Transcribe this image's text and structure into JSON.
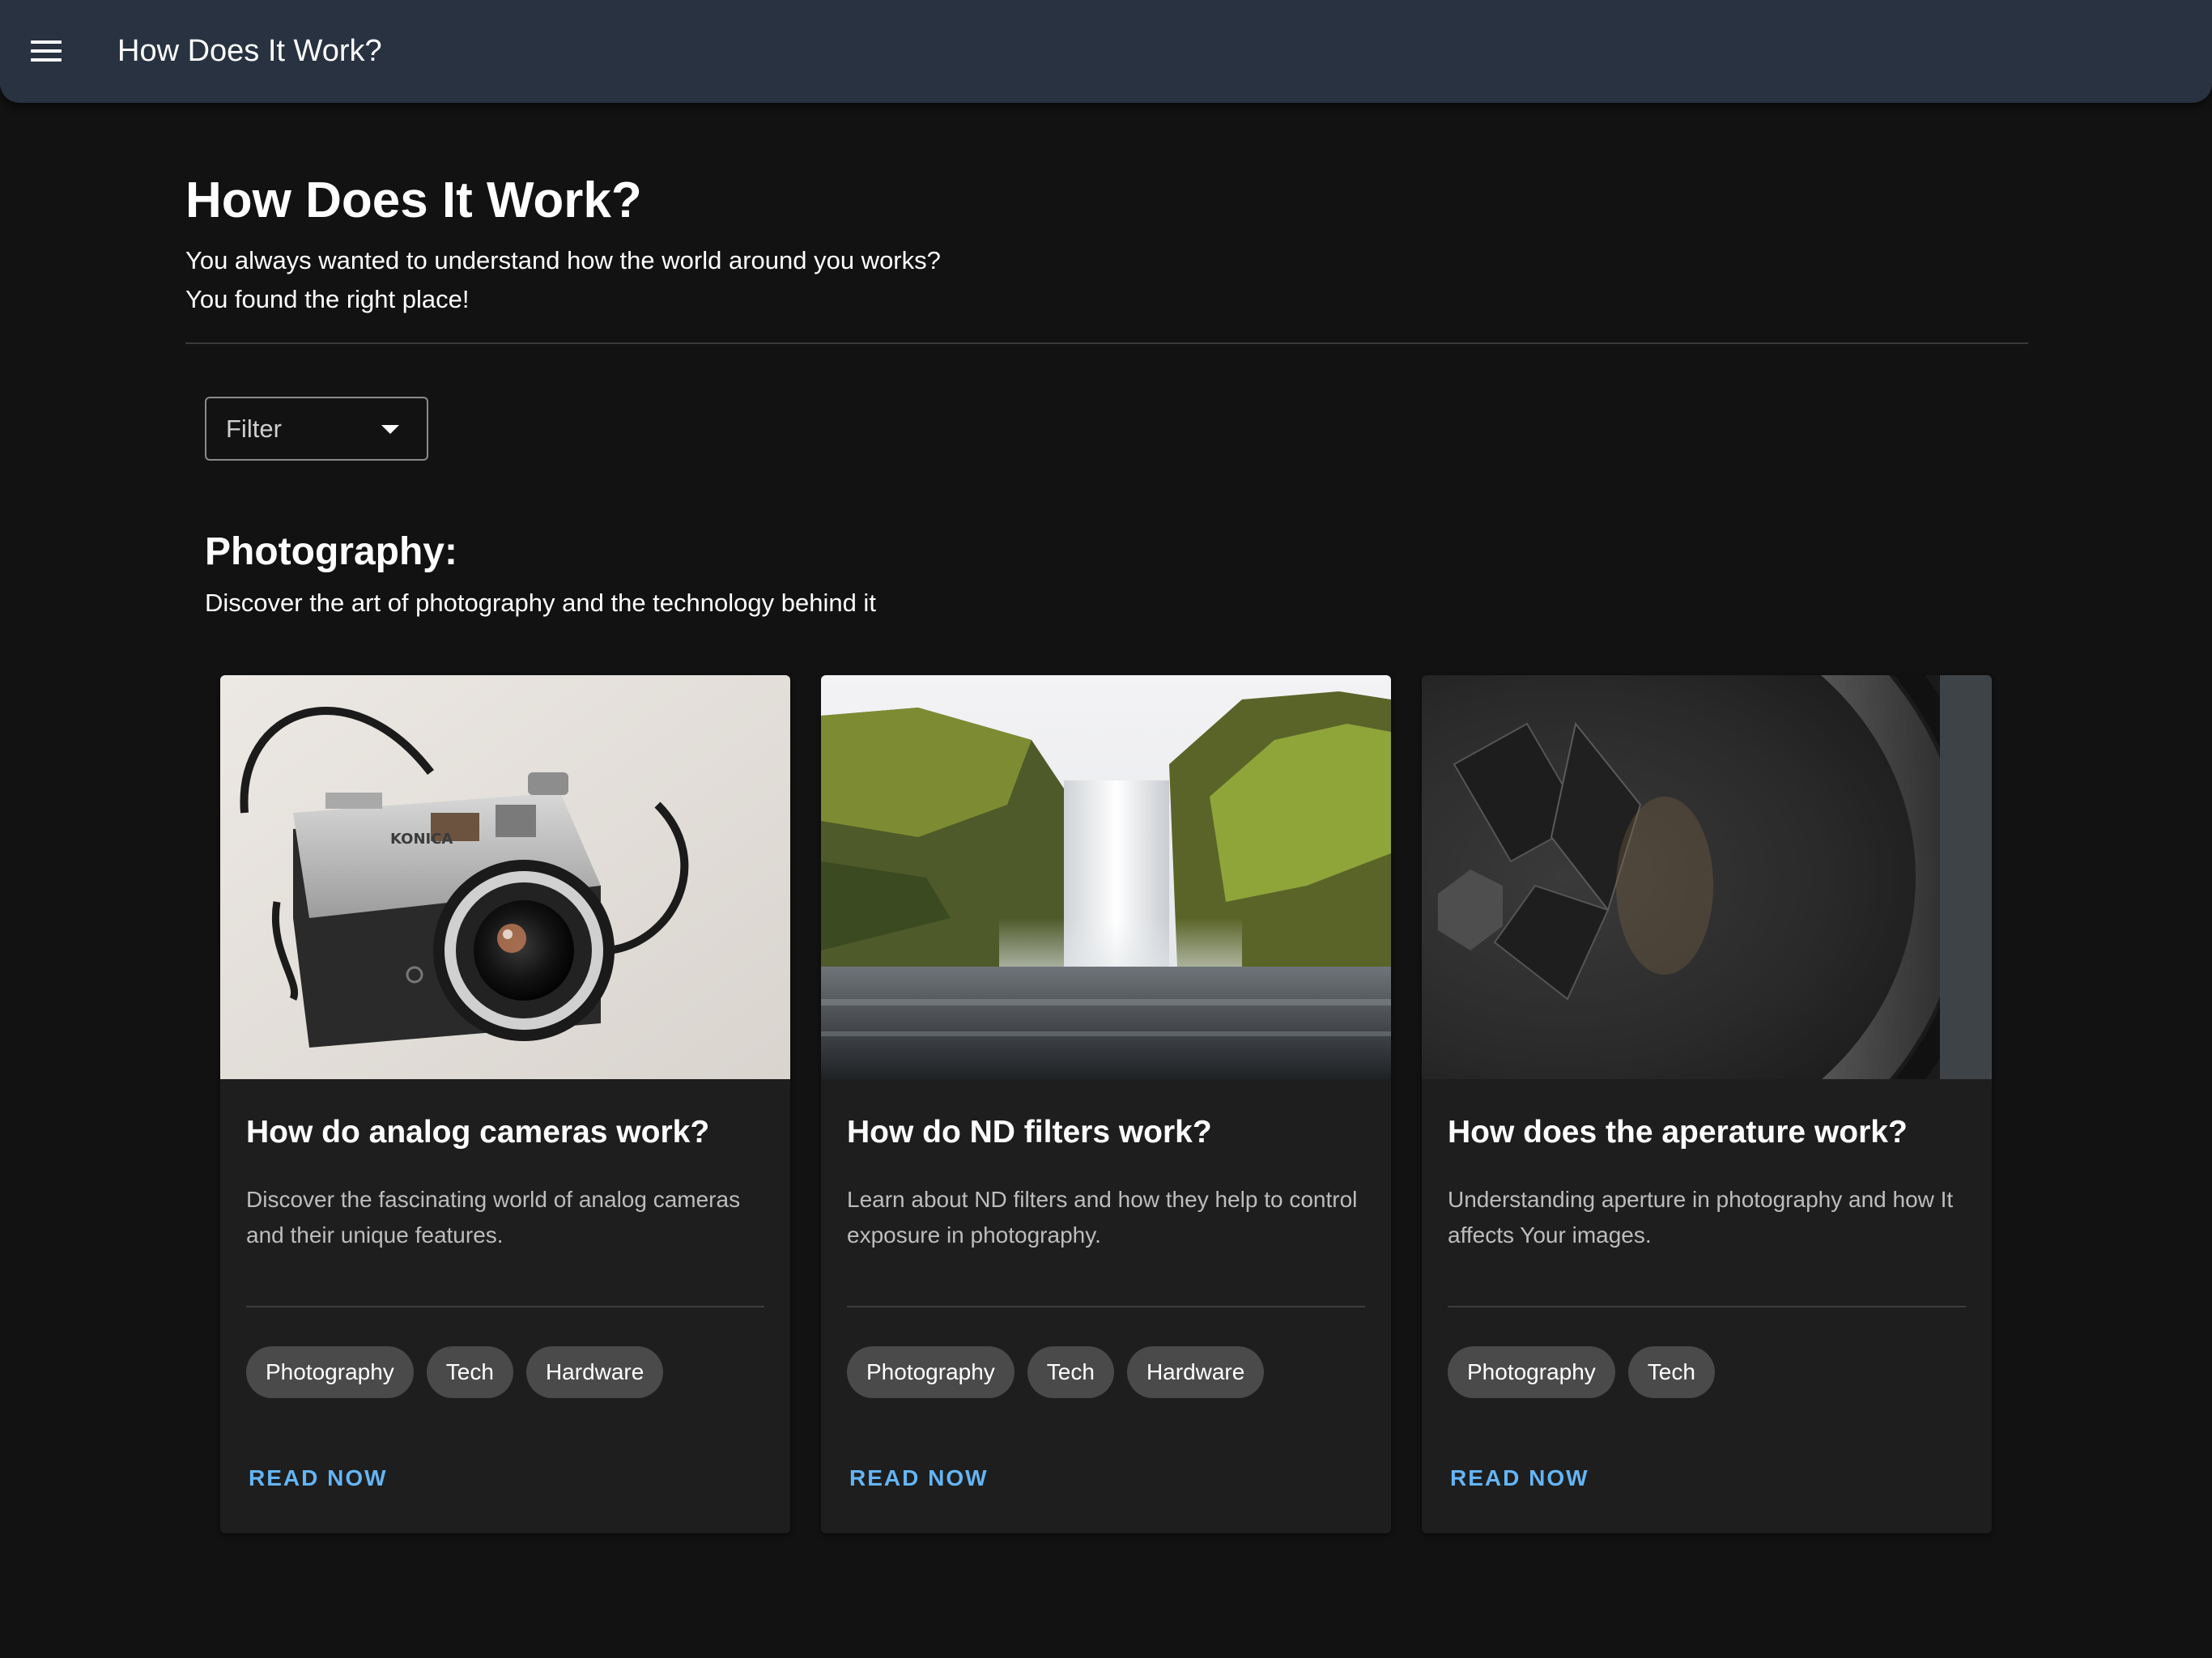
{
  "appbar": {
    "title": "How Does It Work?"
  },
  "header": {
    "title": "How Does It Work?",
    "subtitle_line1": "You always wanted to understand how the world around you works?",
    "subtitle_line2": "You found the right place!"
  },
  "filter": {
    "label": "Filter"
  },
  "section": {
    "title": "Photography:",
    "description": "Discover the art of photography and the technology behind it"
  },
  "cards": [
    {
      "title": "How do analog cameras work?",
      "description": "Discover the fascinating world of analog cameras and their unique features.",
      "tags": [
        "Photography",
        "Tech",
        "Hardware"
      ],
      "action": "READ NOW",
      "image_subject": "analog-camera",
      "camera_brand": "KONICA"
    },
    {
      "title": "How do ND filters work?",
      "description": "Learn about ND filters and how they help to control exposure in photography.",
      "tags": [
        "Photography",
        "Tech",
        "Hardware"
      ],
      "action": "READ NOW",
      "image_subject": "waterfall"
    },
    {
      "title": "How does the aperature work?",
      "description": "Understanding aperture in photography and how It affects Your images.",
      "tags": [
        "Photography",
        "Tech"
      ],
      "action": "READ NOW",
      "image_subject": "lens-aperture"
    }
  ],
  "colors": {
    "background": "#121212",
    "appbar": "#283240",
    "card": "#1e1e1e",
    "chip": "#4a4a4a",
    "accent": "#64b5f6"
  }
}
